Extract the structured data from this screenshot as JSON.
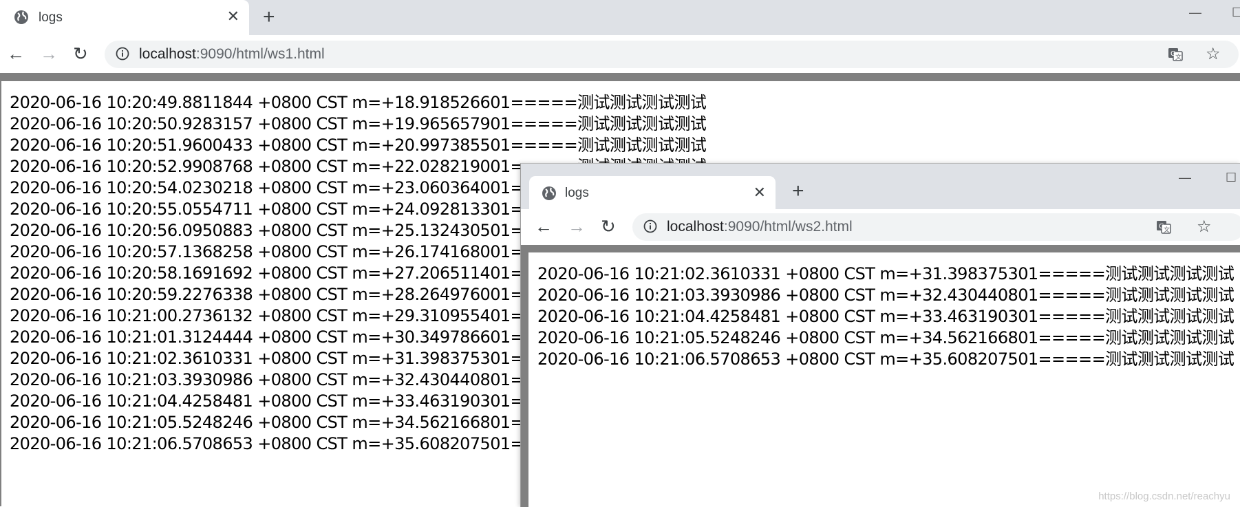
{
  "window1": {
    "tab_title": "logs",
    "url_host": "localhost",
    "url_path": ":9090/html/ws1.html",
    "log_lines": [
      "2020-06-16 10:20:49.8811844 +0800 CST m=+18.918526601=====测试测试测试测试",
      "2020-06-16 10:20:50.9283157 +0800 CST m=+19.965657901=====测试测试测试测试",
      "2020-06-16 10:20:51.9600433 +0800 CST m=+20.997385501=====测试测试测试测试",
      "2020-06-16 10:20:52.9908768 +0800 CST m=+22.028219001=====测试测试测试测试",
      "2020-06-16 10:20:54.0230218 +0800 CST m=+23.060364001=====",
      "2020-06-16 10:20:55.0554711 +0800 CST m=+24.092813301=====",
      "2020-06-16 10:20:56.0950883 +0800 CST m=+25.132430501=====",
      "2020-06-16 10:20:57.1368258 +0800 CST m=+26.174168001=====",
      "2020-06-16 10:20:58.1691692 +0800 CST m=+27.206511401=====",
      "2020-06-16 10:20:59.2276338 +0800 CST m=+28.264976001=====",
      "2020-06-16 10:21:00.2736132 +0800 CST m=+29.310955401=====",
      "2020-06-16 10:21:01.3124444 +0800 CST m=+30.349786601=====",
      "2020-06-16 10:21:02.3610331 +0800 CST m=+31.398375301=====",
      "2020-06-16 10:21:03.3930986 +0800 CST m=+32.430440801=====",
      "2020-06-16 10:21:04.4258481 +0800 CST m=+33.463190301=====",
      "2020-06-16 10:21:05.5248246 +0800 CST m=+34.562166801=====",
      "2020-06-16 10:21:06.5708653 +0800 CST m=+35.608207501====="
    ]
  },
  "window2": {
    "tab_title": "logs",
    "url_host": "localhost",
    "url_path": ":9090/html/ws2.html",
    "log_lines": [
      "2020-06-16 10:21:02.3610331 +0800 CST m=+31.398375301=====测试测试测试测试",
      "2020-06-16 10:21:03.3930986 +0800 CST m=+32.430440801=====测试测试测试测试",
      "2020-06-16 10:21:04.4258481 +0800 CST m=+33.463190301=====测试测试测试测试",
      "2020-06-16 10:21:05.5248246 +0800 CST m=+34.562166801=====测试测试测试测试",
      "2020-06-16 10:21:06.5708653 +0800 CST m=+35.608207501=====测试测试测试测试"
    ]
  },
  "icons": {
    "tab_close": "✕",
    "new_tab": "+",
    "back": "←",
    "forward": "→",
    "reload": "↻",
    "bookmark": "☆",
    "minimize": "—",
    "maximize": "☐"
  },
  "watermark": "https://blog.csdn.net/reachyu"
}
